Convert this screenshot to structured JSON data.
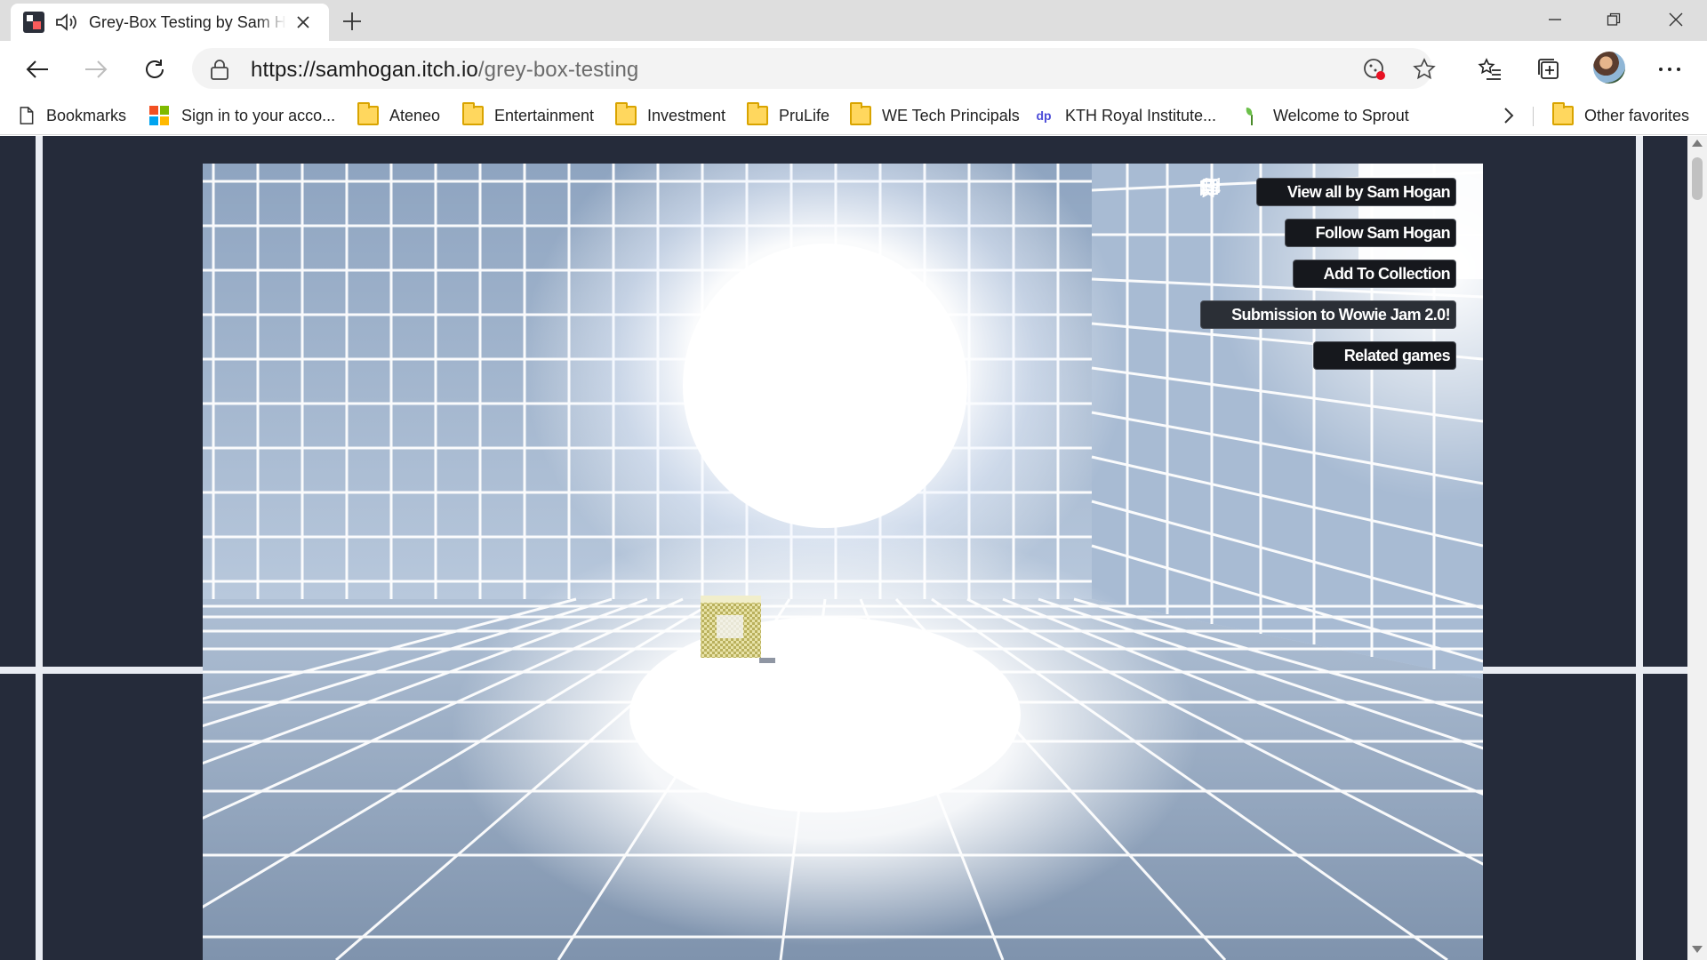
{
  "browser": {
    "tab_title": "Grey-Box Testing by Sam Hogan",
    "url_host": "https://samhogan.itch.io",
    "url_path": "/grey-box-testing"
  },
  "bookmarks": [
    {
      "label": "Bookmarks",
      "icon": "page-icon"
    },
    {
      "label": "Sign in to your acco...",
      "icon": "microsoft-logo-icon"
    },
    {
      "label": "Ateneo",
      "icon": "folder-icon"
    },
    {
      "label": "Entertainment",
      "icon": "folder-icon"
    },
    {
      "label": "Investment",
      "icon": "folder-icon"
    },
    {
      "label": "PruLife",
      "icon": "folder-icon"
    },
    {
      "label": "WE Tech Principals",
      "icon": "folder-icon"
    },
    {
      "label": "KTH Royal Institute...",
      "icon": "dp-icon"
    },
    {
      "label": "Welcome to Sprout",
      "icon": "sprout-icon"
    },
    {
      "label": "Other favorites",
      "icon": "folder-icon"
    }
  ],
  "side_buttons": [
    {
      "label": "View all by Sam Hogan",
      "icon": "store-icon"
    },
    {
      "label": "Follow Sam Hogan",
      "icon": "follow-user-icon"
    },
    {
      "label": "Add To Collection",
      "icon": "add-list-icon"
    },
    {
      "label": "Submission to Wowie Jam 2.0!",
      "icon": "award-icon"
    },
    {
      "label": "Related games",
      "icon": "map-icon"
    }
  ],
  "colors": {
    "page_bg": "#252b3a",
    "button_bg": "#16181d",
    "grid_line": "#ffffff",
    "wall": "#b7c7dc"
  }
}
